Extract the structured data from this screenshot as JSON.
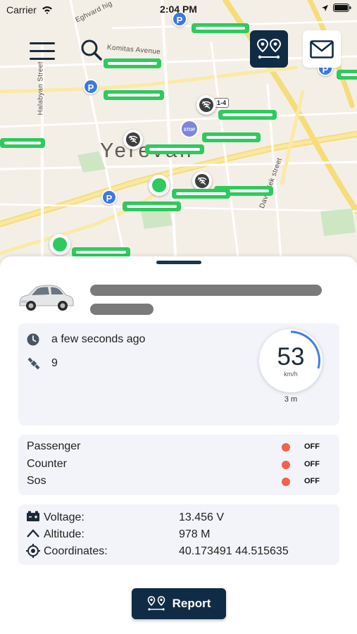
{
  "status_bar": {
    "carrier": "Carrier",
    "time": "2:04 PM"
  },
  "map": {
    "city_label": "Yerevan",
    "streets": [
      "Eghvard hig",
      "Komitas Avenue",
      "Halabyan Street",
      "Davit Bek street"
    ],
    "road_shield": "1-4",
    "stop_sign": "STOP",
    "parking_symbol": "P"
  },
  "header": {
    "menu_icon": "menu-icon",
    "search_icon": "search-icon",
    "route_icon": "route-icon",
    "mail_icon": "mail-icon"
  },
  "vehicle": {
    "last_update": "a few seconds ago",
    "satellites": "9",
    "speed": "53",
    "speed_unit": "km/h",
    "accuracy": "3 m"
  },
  "sensors": [
    {
      "name": "Passenger",
      "state": "OFF",
      "color": "#f4614a"
    },
    {
      "name": "Counter",
      "state": "OFF",
      "color": "#f4614a"
    },
    {
      "name": "Sos",
      "state": "OFF",
      "color": "#f4614a"
    }
  ],
  "params": [
    {
      "label": "Voltage:",
      "value": "13.456 V",
      "icon": "battery-icon"
    },
    {
      "label": "Altitude:",
      "value": "978 M",
      "icon": "altitude-icon"
    },
    {
      "label": "Coordinates:",
      "value": "40.173491 44.515635",
      "icon": "location-icon"
    }
  ],
  "actions": {
    "report_label": "Report"
  },
  "colors": {
    "primary": "#102b45",
    "marker_green": "#2fca5e",
    "parking_blue": "#3d78e0",
    "status_red": "#f4614a"
  }
}
